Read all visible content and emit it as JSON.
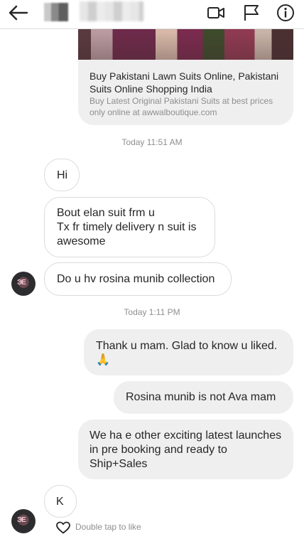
{
  "header": {
    "back_icon": "arrow-left-icon",
    "video_icon": "video-camera-icon",
    "flag_icon": "flag-icon",
    "info_icon": "info-icon"
  },
  "link_preview": {
    "title": "Buy Pakistani Lawn Suits Online, Pakistani Suits Online Shopping India",
    "description": "Buy Latest Original Pakistani Suits at best prices only online at awwalboutique.com"
  },
  "timestamps": {
    "first": "Today 11:51 AM",
    "second": "Today 1:11 PM"
  },
  "messages": [
    {
      "from": "them",
      "text": "Hi"
    },
    {
      "from": "them",
      "text": "Bout elan suit frm u\nTx fr timely delivery n suit is awesome"
    },
    {
      "from": "them",
      "text": "Do u hv rosina munib collection"
    },
    {
      "from": "me",
      "text": "Thank u mam. Glad to know u liked.\n🙏"
    },
    {
      "from": "me",
      "text": "Rosina munib is not Ava mam"
    },
    {
      "from": "me",
      "text": "We ha e other exciting latest launches in pre booking and ready to Ship+Sales"
    },
    {
      "from": "them",
      "text": "K"
    }
  ],
  "footer": {
    "heart_icon": "heart-icon",
    "like_hint": "Double tap to like"
  }
}
